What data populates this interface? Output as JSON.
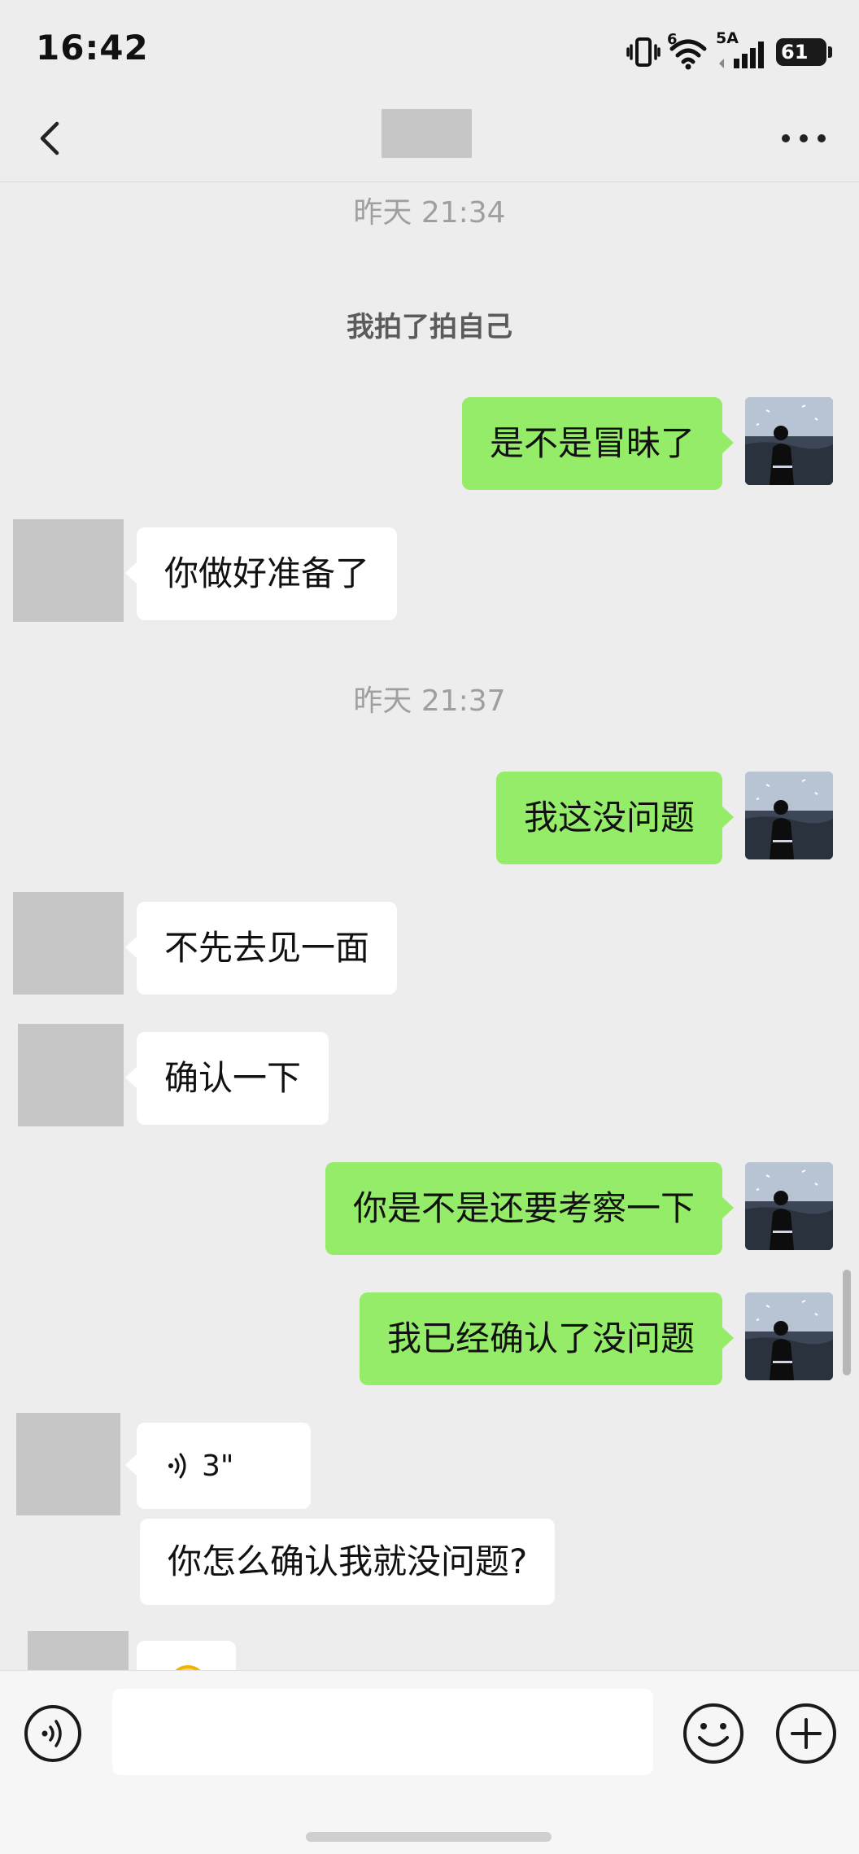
{
  "status_bar": {
    "time": "16:42",
    "net_sup": "6",
    "net_type": "5A",
    "battery": "61"
  },
  "header": {
    "title": ""
  },
  "colors": {
    "background": "#ededed",
    "sent_bubble": "#95ec69",
    "received_bubble": "#ffffff",
    "timestamp_text": "#9f9f9f"
  },
  "icons": {
    "back": "chevron-left-icon",
    "more": "more-dots-icon",
    "voice_toggle": "voice-icon",
    "emoji": "smiley-icon",
    "plus": "plus-circle-icon"
  },
  "chat": {
    "timestamp_1": "昨天 21:34",
    "system_1": "我拍了拍自己",
    "msg_1": "是不是冒昧了",
    "msg_2": "你做好准备了",
    "timestamp_2": "昨天 21:37",
    "msg_3": "我这没问题",
    "msg_4": "不先去见一面",
    "msg_5": "确认一下",
    "msg_6": "你是不是还要考察一下",
    "msg_7": "我已经确认了没问题",
    "voice_duration": "3\"",
    "msg_8": "你怎么确认我就没问题?"
  },
  "input": {
    "value": "",
    "placeholder": ""
  }
}
